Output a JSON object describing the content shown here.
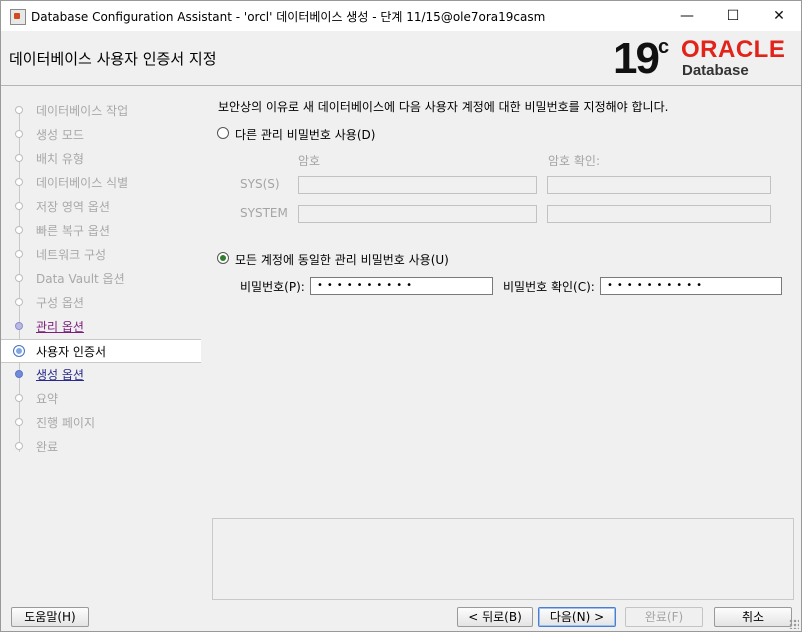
{
  "window": {
    "title": "Database Configuration Assistant - 'orcl' 데이터베이스 생성 - 단계 11/15@ole7ora19casm",
    "minimize": "—",
    "maximize": "☐",
    "close": "✕"
  },
  "header": {
    "page_title": "데이터베이스 사용자 인증서 지정",
    "logo_number": "19",
    "logo_sup": "c",
    "logo_brand": "ORACLE",
    "logo_product": "Database"
  },
  "steps": [
    {
      "label": "데이터베이스 작업",
      "state": "disabled"
    },
    {
      "label": "생성 모드",
      "state": "disabled"
    },
    {
      "label": "배치 유형",
      "state": "disabled"
    },
    {
      "label": "데이터베이스 식별",
      "state": "disabled"
    },
    {
      "label": "저장 영역 옵션",
      "state": "disabled"
    },
    {
      "label": "빠른 복구 옵션",
      "state": "disabled"
    },
    {
      "label": "네트워크 구성",
      "state": "disabled"
    },
    {
      "label": "Data Vault 옵션",
      "state": "disabled"
    },
    {
      "label": "구성 옵션",
      "state": "disabled"
    },
    {
      "label": "관리 옵션",
      "state": "visited"
    },
    {
      "label": "사용자 인증서",
      "state": "current"
    },
    {
      "label": "생성 옵션",
      "state": "link"
    },
    {
      "label": "요약",
      "state": "disabled"
    },
    {
      "label": "진행 페이지",
      "state": "disabled"
    },
    {
      "label": "완료",
      "state": "disabled"
    }
  ],
  "main": {
    "description": "보안상의 이유로 새 데이터베이스에 다음 사용자 계정에 대한 비밀번호를 지정해야 합니다.",
    "option_separate": {
      "label": "다른 관리 비밀번호 사용(D)",
      "checked": false,
      "col_password": "암호",
      "col_confirm": "암호 확인:",
      "rows": [
        {
          "label": "SYS(S)"
        },
        {
          "label": "SYSTEM"
        }
      ]
    },
    "option_same": {
      "label": "모든 계정에 동일한 관리 비밀번호 사용(U)",
      "checked": true,
      "password_label": "비밀번호(P):",
      "password_value": "••••••••••",
      "confirm_label": "비밀번호 확인(C):",
      "confirm_value": "••••••••••"
    }
  },
  "footer": {
    "help": "도움말(H)",
    "back": "< 뒤로(B)",
    "next": "다음(N) >",
    "finish": "완료(F)",
    "cancel": "취소"
  }
}
